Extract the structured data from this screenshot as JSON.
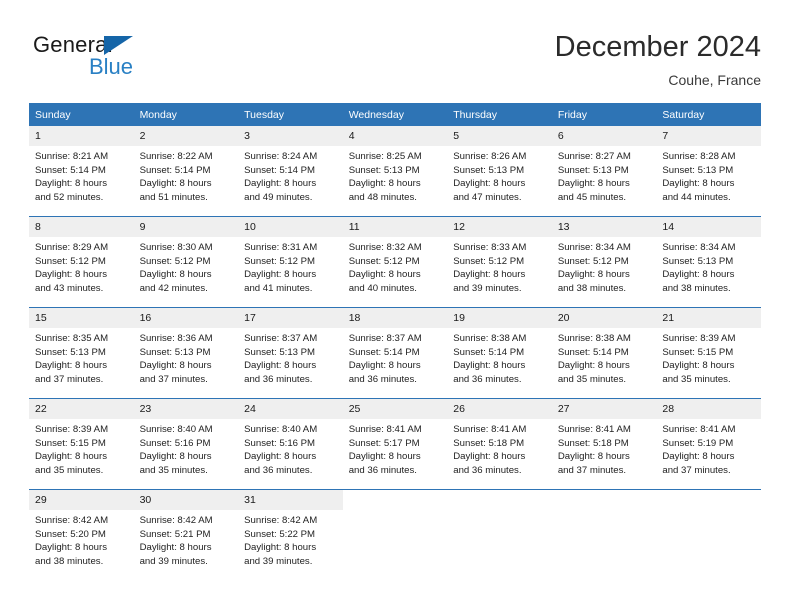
{
  "brand": {
    "word_one": "General",
    "word_two": "Blue",
    "triangle_icon": "blue-triangle-logo-icon"
  },
  "header": {
    "month_title": "December 2024",
    "location": "Couhe, France"
  },
  "colors": {
    "header_blue": "#2e74b5",
    "brand_blue": "#2980c4",
    "daynum_band": "#efefef",
    "text": "#1f1f1f"
  },
  "weekdays": [
    "Sunday",
    "Monday",
    "Tuesday",
    "Wednesday",
    "Thursday",
    "Friday",
    "Saturday"
  ],
  "weeks": [
    [
      {
        "day": "1",
        "sunrise": "Sunrise: 8:21 AM",
        "sunset": "Sunset: 5:14 PM",
        "daylight_1": "Daylight: 8 hours",
        "daylight_2": "and 52 minutes."
      },
      {
        "day": "2",
        "sunrise": "Sunrise: 8:22 AM",
        "sunset": "Sunset: 5:14 PM",
        "daylight_1": "Daylight: 8 hours",
        "daylight_2": "and 51 minutes."
      },
      {
        "day": "3",
        "sunrise": "Sunrise: 8:24 AM",
        "sunset": "Sunset: 5:14 PM",
        "daylight_1": "Daylight: 8 hours",
        "daylight_2": "and 49 minutes."
      },
      {
        "day": "4",
        "sunrise": "Sunrise: 8:25 AM",
        "sunset": "Sunset: 5:13 PM",
        "daylight_1": "Daylight: 8 hours",
        "daylight_2": "and 48 minutes."
      },
      {
        "day": "5",
        "sunrise": "Sunrise: 8:26 AM",
        "sunset": "Sunset: 5:13 PM",
        "daylight_1": "Daylight: 8 hours",
        "daylight_2": "and 47 minutes."
      },
      {
        "day": "6",
        "sunrise": "Sunrise: 8:27 AM",
        "sunset": "Sunset: 5:13 PM",
        "daylight_1": "Daylight: 8 hours",
        "daylight_2": "and 45 minutes."
      },
      {
        "day": "7",
        "sunrise": "Sunrise: 8:28 AM",
        "sunset": "Sunset: 5:13 PM",
        "daylight_1": "Daylight: 8 hours",
        "daylight_2": "and 44 minutes."
      }
    ],
    [
      {
        "day": "8",
        "sunrise": "Sunrise: 8:29 AM",
        "sunset": "Sunset: 5:12 PM",
        "daylight_1": "Daylight: 8 hours",
        "daylight_2": "and 43 minutes."
      },
      {
        "day": "9",
        "sunrise": "Sunrise: 8:30 AM",
        "sunset": "Sunset: 5:12 PM",
        "daylight_1": "Daylight: 8 hours",
        "daylight_2": "and 42 minutes."
      },
      {
        "day": "10",
        "sunrise": "Sunrise: 8:31 AM",
        "sunset": "Sunset: 5:12 PM",
        "daylight_1": "Daylight: 8 hours",
        "daylight_2": "and 41 minutes."
      },
      {
        "day": "11",
        "sunrise": "Sunrise: 8:32 AM",
        "sunset": "Sunset: 5:12 PM",
        "daylight_1": "Daylight: 8 hours",
        "daylight_2": "and 40 minutes."
      },
      {
        "day": "12",
        "sunrise": "Sunrise: 8:33 AM",
        "sunset": "Sunset: 5:12 PM",
        "daylight_1": "Daylight: 8 hours",
        "daylight_2": "and 39 minutes."
      },
      {
        "day": "13",
        "sunrise": "Sunrise: 8:34 AM",
        "sunset": "Sunset: 5:12 PM",
        "daylight_1": "Daylight: 8 hours",
        "daylight_2": "and 38 minutes."
      },
      {
        "day": "14",
        "sunrise": "Sunrise: 8:34 AM",
        "sunset": "Sunset: 5:13 PM",
        "daylight_1": "Daylight: 8 hours",
        "daylight_2": "and 38 minutes."
      }
    ],
    [
      {
        "day": "15",
        "sunrise": "Sunrise: 8:35 AM",
        "sunset": "Sunset: 5:13 PM",
        "daylight_1": "Daylight: 8 hours",
        "daylight_2": "and 37 minutes."
      },
      {
        "day": "16",
        "sunrise": "Sunrise: 8:36 AM",
        "sunset": "Sunset: 5:13 PM",
        "daylight_1": "Daylight: 8 hours",
        "daylight_2": "and 37 minutes."
      },
      {
        "day": "17",
        "sunrise": "Sunrise: 8:37 AM",
        "sunset": "Sunset: 5:13 PM",
        "daylight_1": "Daylight: 8 hours",
        "daylight_2": "and 36 minutes."
      },
      {
        "day": "18",
        "sunrise": "Sunrise: 8:37 AM",
        "sunset": "Sunset: 5:14 PM",
        "daylight_1": "Daylight: 8 hours",
        "daylight_2": "and 36 minutes."
      },
      {
        "day": "19",
        "sunrise": "Sunrise: 8:38 AM",
        "sunset": "Sunset: 5:14 PM",
        "daylight_1": "Daylight: 8 hours",
        "daylight_2": "and 36 minutes."
      },
      {
        "day": "20",
        "sunrise": "Sunrise: 8:38 AM",
        "sunset": "Sunset: 5:14 PM",
        "daylight_1": "Daylight: 8 hours",
        "daylight_2": "and 35 minutes."
      },
      {
        "day": "21",
        "sunrise": "Sunrise: 8:39 AM",
        "sunset": "Sunset: 5:15 PM",
        "daylight_1": "Daylight: 8 hours",
        "daylight_2": "and 35 minutes."
      }
    ],
    [
      {
        "day": "22",
        "sunrise": "Sunrise: 8:39 AM",
        "sunset": "Sunset: 5:15 PM",
        "daylight_1": "Daylight: 8 hours",
        "daylight_2": "and 35 minutes."
      },
      {
        "day": "23",
        "sunrise": "Sunrise: 8:40 AM",
        "sunset": "Sunset: 5:16 PM",
        "daylight_1": "Daylight: 8 hours",
        "daylight_2": "and 35 minutes."
      },
      {
        "day": "24",
        "sunrise": "Sunrise: 8:40 AM",
        "sunset": "Sunset: 5:16 PM",
        "daylight_1": "Daylight: 8 hours",
        "daylight_2": "and 36 minutes."
      },
      {
        "day": "25",
        "sunrise": "Sunrise: 8:41 AM",
        "sunset": "Sunset: 5:17 PM",
        "daylight_1": "Daylight: 8 hours",
        "daylight_2": "and 36 minutes."
      },
      {
        "day": "26",
        "sunrise": "Sunrise: 8:41 AM",
        "sunset": "Sunset: 5:18 PM",
        "daylight_1": "Daylight: 8 hours",
        "daylight_2": "and 36 minutes."
      },
      {
        "day": "27",
        "sunrise": "Sunrise: 8:41 AM",
        "sunset": "Sunset: 5:18 PM",
        "daylight_1": "Daylight: 8 hours",
        "daylight_2": "and 37 minutes."
      },
      {
        "day": "28",
        "sunrise": "Sunrise: 8:41 AM",
        "sunset": "Sunset: 5:19 PM",
        "daylight_1": "Daylight: 8 hours",
        "daylight_2": "and 37 minutes."
      }
    ],
    [
      {
        "day": "29",
        "sunrise": "Sunrise: 8:42 AM",
        "sunset": "Sunset: 5:20 PM",
        "daylight_1": "Daylight: 8 hours",
        "daylight_2": "and 38 minutes."
      },
      {
        "day": "30",
        "sunrise": "Sunrise: 8:42 AM",
        "sunset": "Sunset: 5:21 PM",
        "daylight_1": "Daylight: 8 hours",
        "daylight_2": "and 39 minutes."
      },
      {
        "day": "31",
        "sunrise": "Sunrise: 8:42 AM",
        "sunset": "Sunset: 5:22 PM",
        "daylight_1": "Daylight: 8 hours",
        "daylight_2": "and 39 minutes."
      },
      {
        "day": "",
        "sunrise": "",
        "sunset": "",
        "daylight_1": "",
        "daylight_2": ""
      },
      {
        "day": "",
        "sunrise": "",
        "sunset": "",
        "daylight_1": "",
        "daylight_2": ""
      },
      {
        "day": "",
        "sunrise": "",
        "sunset": "",
        "daylight_1": "",
        "daylight_2": ""
      },
      {
        "day": "",
        "sunrise": "",
        "sunset": "",
        "daylight_1": "",
        "daylight_2": ""
      }
    ]
  ]
}
